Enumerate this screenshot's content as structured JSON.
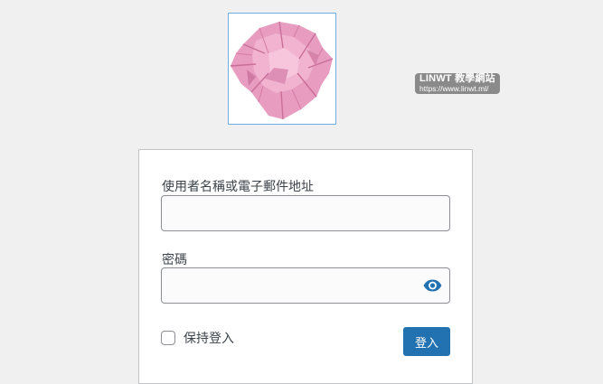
{
  "logo": {
    "alt": "crumpled pink paper logo"
  },
  "watermark": {
    "title": "LINWT 教學網站",
    "url": "https://www.linwt.ml/"
  },
  "form": {
    "username_label": "使用者名稱或電子郵件地址",
    "username_value": "",
    "password_label": "密碼",
    "password_value": "",
    "remember_label": "保持登入",
    "submit_label": "登入"
  },
  "colors": {
    "accent": "#2271b1",
    "background": "#f0f0f1",
    "border": "#8c8f94"
  },
  "icons": {
    "show_password": "eye-icon"
  }
}
